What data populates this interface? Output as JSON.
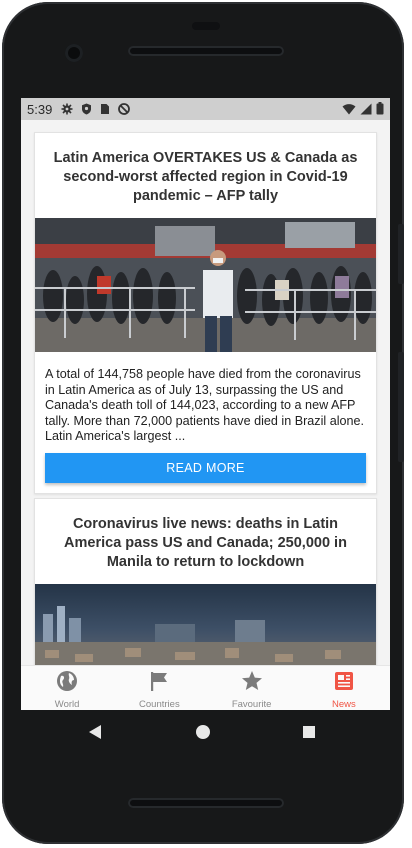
{
  "status_bar": {
    "time": "5:39"
  },
  "articles": [
    {
      "title": "Latin America OVERTAKES US & Canada as second-worst affected region in Covid-19 pandemic – AFP tally",
      "description": "A total of 144,758 people have died from the coronavirus in Latin America as of July 13, surpassing the US and Canada's death toll of 144,023, according to a new AFP tally. More than 72,000 patients have died in Brazil alone. Latin America's largest ...",
      "button_label": "READ MORE"
    },
    {
      "title": "Coronavirus live news: deaths in Latin America pass US and Canada; 250,000 in Manila to return to lockdown"
    }
  ],
  "bottom_nav": [
    {
      "label": "World",
      "icon": "globe-icon",
      "active": false
    },
    {
      "label": "Countries",
      "icon": "flag-icon",
      "active": false
    },
    {
      "label": "Favourite",
      "icon": "star-icon",
      "active": false
    },
    {
      "label": "News",
      "icon": "newspaper-icon",
      "active": true
    }
  ],
  "colors": {
    "accent": "#2196f3",
    "active_nav": "#f05545",
    "inactive_nav": "#8a8a8a"
  }
}
